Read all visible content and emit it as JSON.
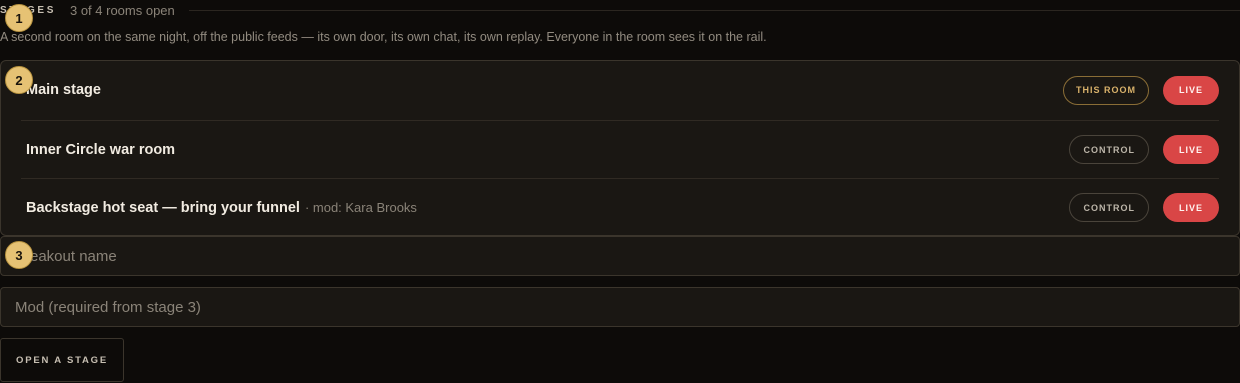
{
  "stages": {
    "title": "STAGES",
    "count": "3 of 4 rooms open",
    "description": "A second room on the same night, off the public feeds — its own door, its own chat, its own replay. Everyone in the room sees it on the rail."
  },
  "rooms": [
    {
      "name": "Main stage",
      "mod": "",
      "action_label": "THIS ROOM",
      "status_label": "LIVE"
    },
    {
      "name": "Inner Circle war room",
      "mod": "",
      "action_label": "CONTROL",
      "status_label": "LIVE"
    },
    {
      "name": "Backstage hot seat — bring your funnel",
      "mod": "· mod: Kara Brooks",
      "action_label": "CONTROL",
      "status_label": "LIVE"
    }
  ],
  "form": {
    "name_placeholder": "Breakout name",
    "mod_placeholder": "Mod (required from stage 3)",
    "submit_label": "OPEN A STAGE"
  },
  "markers": [
    "1",
    "2",
    "3"
  ],
  "colors": {
    "background": "#0d0b09",
    "panel": "#1a1713",
    "live": "#d94646",
    "accent_gold": "#d9b26b",
    "marker": "#e6c274"
  }
}
